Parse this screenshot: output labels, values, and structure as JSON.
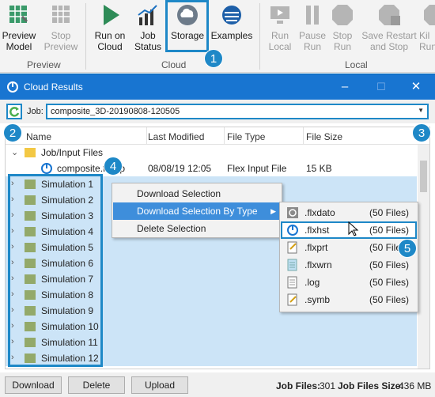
{
  "ribbon": {
    "buttons": [
      {
        "label": "Preview\nModel",
        "icon": "preview-model-icon"
      },
      {
        "label": "Stop\nPreview",
        "icon": "stop-preview-icon"
      },
      {
        "label": "Run on\nCloud",
        "icon": "run-cloud-icon"
      },
      {
        "label": "Job\nStatus",
        "icon": "job-status-icon"
      },
      {
        "label": "Storage",
        "icon": "cloud-storage-icon"
      },
      {
        "label": "Examples",
        "icon": "examples-icon"
      },
      {
        "label": "Run\nLocal",
        "icon": "run-local-icon"
      },
      {
        "label": "Pause\nRun",
        "icon": "pause-run-icon"
      },
      {
        "label": "Stop\nRun",
        "icon": "stop-run-icon"
      },
      {
        "label": "Save Restart\nand Stop",
        "icon": "save-restart-icon"
      },
      {
        "label": "Kil\nRun",
        "icon": "kill-run-icon"
      }
    ],
    "groups": [
      "Preview",
      "Cloud",
      "Local"
    ]
  },
  "window": {
    "title": "Cloud Results",
    "job_label": "Job:",
    "job_value": "composite_3D-20190808-120505"
  },
  "table": {
    "headers": [
      "Name",
      "Last Modified",
      "File Type",
      "File Size"
    ],
    "folder": "Job/Input Files",
    "file": {
      "name": "composite.flxinp",
      "modified": "08/08/19 12:05",
      "type": "Flex Input File",
      "size": "15 KB"
    },
    "simulations": [
      "Simulation 1",
      "Simulation 2",
      "Simulation 3",
      "Simulation 4",
      "Simulation 5",
      "Simulation 6",
      "Simulation 7",
      "Simulation 8",
      "Simulation 9",
      "Simulation 10",
      "Simulation 11",
      "Simulation 12"
    ]
  },
  "context_menu": {
    "items": [
      "Download Selection",
      "Download Selection By Type",
      "Delete Selection"
    ]
  },
  "submenu": {
    "items": [
      {
        "ext": ".flxdato",
        "count": "(50 Files)"
      },
      {
        "ext": ".flxhst",
        "count": "(50 Files)"
      },
      {
        "ext": ".flxprt",
        "count": "(50 Files)"
      },
      {
        "ext": ".flxwrn",
        "count": "(50 Files)"
      },
      {
        "ext": ".log",
        "count": "(50 Files)"
      },
      {
        "ext": ".symb",
        "count": "(50 Files)"
      }
    ]
  },
  "footer": {
    "download": "Download",
    "delete": "Delete",
    "upload": "Upload",
    "job_files_label": "Job Files:",
    "job_files_value": "301",
    "job_size_label": "Job Files Size:",
    "job_size_value": "436 MB"
  },
  "badges": [
    "1",
    "2",
    "3",
    "4",
    "5"
  ],
  "colors": {
    "accent": "#1e88c7",
    "titlebar": "#1875d1",
    "selection": "#cce4f7",
    "menu_highlight": "#3e8edb"
  }
}
